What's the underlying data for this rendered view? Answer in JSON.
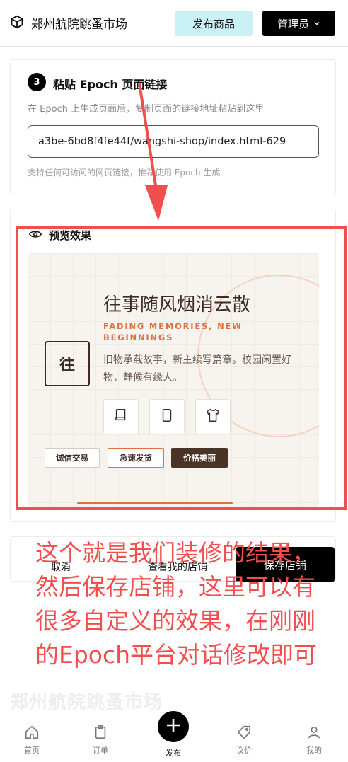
{
  "header": {
    "brand_name": "郑州航院跳蚤市场",
    "publish_label": "发布商品",
    "admin_label": "管理员"
  },
  "step": {
    "number": "3",
    "title": "粘贴 Epoch 页面链接",
    "description": "在 Epoch 上生成页面后，复制页面的链接地址粘贴到这里",
    "url_value": "629-a3be-6bd8f4fe44f/wangshi-shop/index.html",
    "hint": "支持任何可访问的网页链接，推荐使用 Epoch 生成"
  },
  "preview": {
    "title": "预览效果",
    "logo_char": "往",
    "shop_title": "往事随风烟消云散",
    "shop_subtitle": "FADING MEMORIES, NEW BEGINNINGS",
    "shop_desc": "旧物承载故事，新主续写篇章。校园闲置好物，静候有缘人。",
    "tags": [
      "诚信交易",
      "急速发货",
      "价格美丽"
    ]
  },
  "actions": {
    "cancel_label": "取消",
    "view_label": "查看我的店铺",
    "save_label": "保存店铺"
  },
  "footer_mark": "郑州航院跳蚤市场",
  "annotation": {
    "text": "这个就是我们装修的结果，然后保存店铺，这里可以有很多自定义的效果，在刚刚的Epoch平台对话修改即可",
    "color": "#f24e4e"
  },
  "nav": {
    "home": "首页",
    "orders": "订单",
    "publish": "发布",
    "bargain": "议价",
    "mine": "我的"
  },
  "colors": {
    "accent": "#c9f1f6",
    "brand_dark": "#3d2c24",
    "orange": "#e0703c"
  }
}
